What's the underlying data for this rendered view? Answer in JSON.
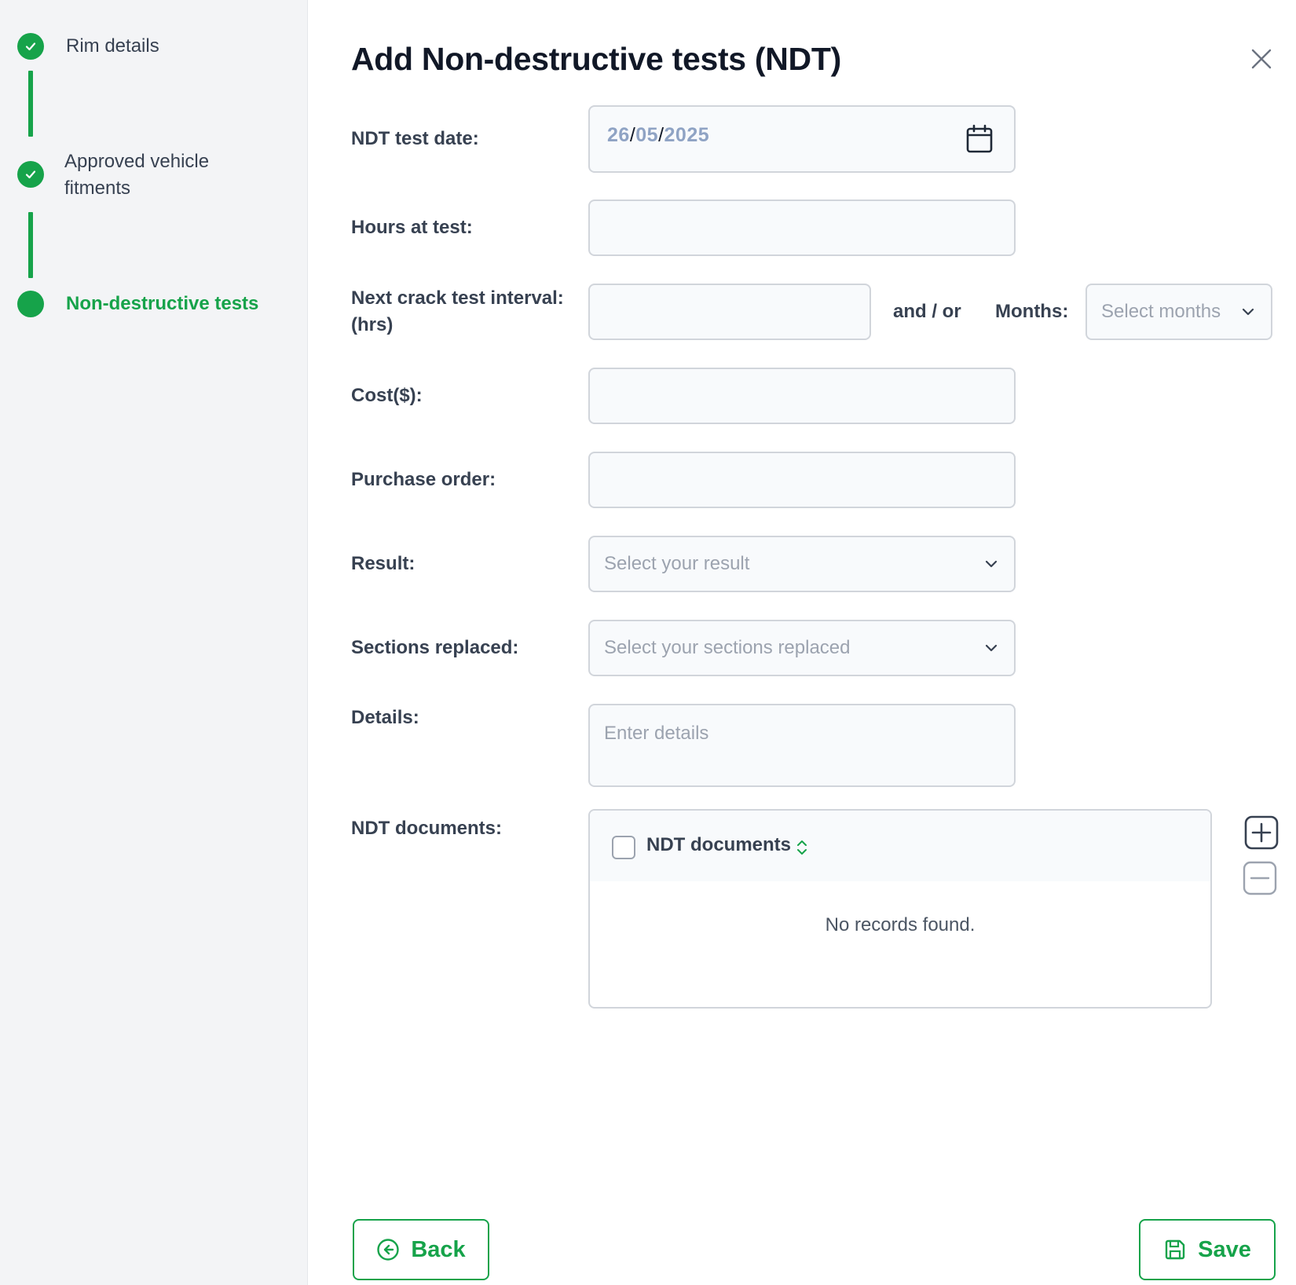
{
  "stepper": {
    "steps": [
      {
        "label": "Rim details",
        "state": "completed"
      },
      {
        "label": "Approved vehicle fitments",
        "state": "completed"
      },
      {
        "label": "Non-destructive tests",
        "state": "active"
      }
    ]
  },
  "header": {
    "title": "Add Non-destructive tests (NDT)"
  },
  "form": {
    "ndt_test_date": {
      "label": "NDT test date:",
      "day": "26",
      "month": "05",
      "year": "2025",
      "separator": "/"
    },
    "hours_at_test": {
      "label": "Hours at test:",
      "value": ""
    },
    "next_crack": {
      "label_line1": "Next crack test interval:",
      "label_line2": "(hrs)",
      "value": "",
      "conjunction": "and / or",
      "months_label": "Months:",
      "months_placeholder": "Select months"
    },
    "cost": {
      "label": "Cost($):",
      "value": ""
    },
    "purchase_order": {
      "label": "Purchase order:",
      "value": ""
    },
    "result": {
      "label": "Result:",
      "placeholder": "Select your result"
    },
    "sections_replaced": {
      "label": "Sections replaced:",
      "placeholder": "Select your sections replaced"
    },
    "details": {
      "label": "Details:",
      "placeholder": "Enter details"
    },
    "ndt_documents": {
      "label": "NDT documents:",
      "column_header": "NDT documents",
      "empty_message": "No records found."
    }
  },
  "footer": {
    "back_label": "Back",
    "save_label": "Save"
  },
  "colors": {
    "accent": "#16a34a",
    "sidebar_bg": "#f3f4f6",
    "field_bg": "#f8fafc",
    "border": "#d1d5db"
  },
  "icons": [
    "check-icon",
    "close-icon",
    "calendar-icon",
    "chevron-down-icon",
    "sort-icon",
    "plus-square-icon",
    "minus-square-icon",
    "arrow-left-circle-icon",
    "save-floppy-icon"
  ]
}
